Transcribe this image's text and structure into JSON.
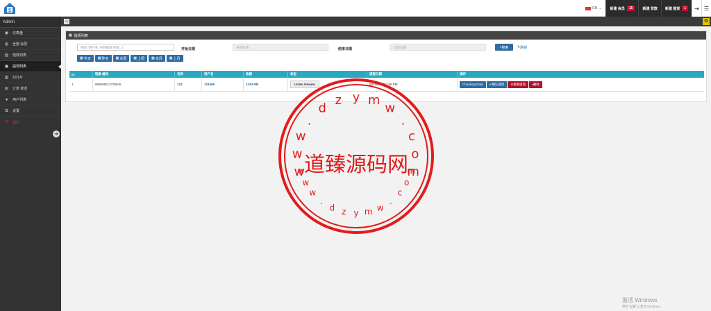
{
  "topbar": {
    "lang": "CN",
    "buttons": [
      {
        "label": "新建 会员",
        "badge": "15"
      },
      {
        "label": "新建 贷款",
        "badge": ""
      },
      {
        "label": "新建 提现",
        "badge": "1"
      }
    ]
  },
  "sidebar": {
    "title": "Admin",
    "items": [
      {
        "label": "仪表盘",
        "icon": "dashboard-icon",
        "glyph": "◉"
      },
      {
        "label": "全部 会员",
        "icon": "users-icon",
        "glyph": "◍"
      },
      {
        "label": "借款列表",
        "icon": "loan-icon",
        "glyph": "▤"
      },
      {
        "label": "提现列表",
        "icon": "withdraw-icon",
        "glyph": "▣"
      },
      {
        "label": "幻灯片",
        "icon": "slides-icon",
        "glyph": "▥"
      },
      {
        "label": "订单 状态",
        "icon": "cart-icon",
        "glyph": "⊞"
      },
      {
        "label": "用户列表",
        "icon": "user-icon",
        "glyph": "●"
      },
      {
        "label": "设置",
        "icon": "gear-icon",
        "glyph": "✿"
      },
      {
        "label": "退出",
        "icon": "logout-icon",
        "glyph": "⏻"
      }
    ],
    "active_index": 3
  },
  "panel": {
    "title": "提现列表",
    "search_placeholder": "搜索 (用户名, 名称数据 列表...)",
    "start_label": "开始日期",
    "start_placeholder": "开始日期",
    "end_label": "结束日期",
    "end_placeholder": "结束日期",
    "search_button": "搜索",
    "refresh_button": "刷新",
    "quick": [
      "今天",
      "昨天",
      "本周",
      "上周",
      "本月",
      "上月"
    ]
  },
  "table": {
    "headers": [
      "ID",
      "取款 编号",
      "名称",
      "用户名",
      "金额",
      "状态",
      "提现日期",
      "操作"
    ],
    "rows": [
      {
        "id": "1",
        "number": "668605512728845",
        "name": "123",
        "username": "123456",
        "amount": "1234 RM",
        "status": "Under Review",
        "date": "02/08/2023 1:56 PM",
        "actions": [
          "Checking Data",
          "确认提现",
          "拒绝提现",
          "删除"
        ]
      }
    ]
  },
  "watermark": {
    "center": "道臻源码网",
    "top_chars": [
      "w",
      "w",
      "w",
      ".",
      "d",
      "z",
      "y",
      "m",
      "w",
      ".",
      "c",
      "o",
      "m"
    ],
    "bottom_chars": [
      "w",
      "w",
      "w",
      ".",
      "d",
      "z",
      "y",
      "m",
      "w",
      ".",
      "c",
      "o",
      "m"
    ],
    "color": "#e31b1b"
  },
  "windows_notice": {
    "title": "激活 Windows",
    "sub": "转到\"设置\"以激活 Windows。"
  }
}
